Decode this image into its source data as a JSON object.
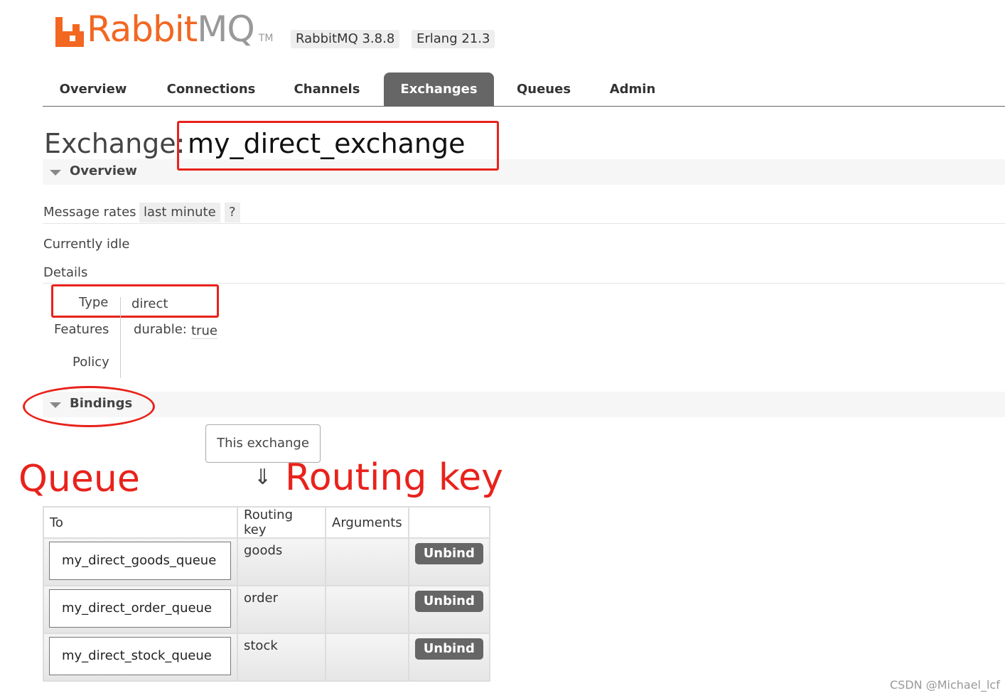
{
  "header": {
    "logo_rabbit": "Rabbit",
    "logo_mq": "MQ",
    "logo_tm": "TM",
    "rabbitmq_version": "RabbitMQ 3.8.8",
    "erlang_version": "Erlang 21.3"
  },
  "tabs": [
    {
      "label": "Overview"
    },
    {
      "label": "Connections"
    },
    {
      "label": "Channels"
    },
    {
      "label": "Exchanges"
    },
    {
      "label": "Queues"
    },
    {
      "label": "Admin"
    }
  ],
  "exchange": {
    "label": "Exchange:",
    "name": "my_direct_exchange"
  },
  "overview_section": {
    "title": "Overview",
    "message_rates_label": "Message rates",
    "rate_period": "last minute",
    "help": "?",
    "idle_text": "Currently idle",
    "details_label": "Details",
    "type_label": "Type",
    "type_value": "direct",
    "features_label": "Features",
    "durable_label": "durable:",
    "durable_value": "true",
    "policy_label": "Policy"
  },
  "bindings_section": {
    "title": "Bindings",
    "this_exchange": "This exchange",
    "arrow": "⇓",
    "columns": [
      "To",
      "Routing key",
      "Arguments",
      ""
    ],
    "rows": [
      {
        "to": "my_direct_goods_queue",
        "routing_key": "goods",
        "arguments": "",
        "action": "Unbind"
      },
      {
        "to": "my_direct_order_queue",
        "routing_key": "order",
        "arguments": "",
        "action": "Unbind"
      },
      {
        "to": "my_direct_stock_queue",
        "routing_key": "stock",
        "arguments": "",
        "action": "Unbind"
      }
    ]
  },
  "annotations": {
    "queue": "Queue",
    "routing_key": "Routing key",
    "color": "#e8221b"
  },
  "watermark": "CSDN @Michael_lcf",
  "colors": {
    "brand_orange": "#f26722",
    "tab_active": "#666666"
  }
}
